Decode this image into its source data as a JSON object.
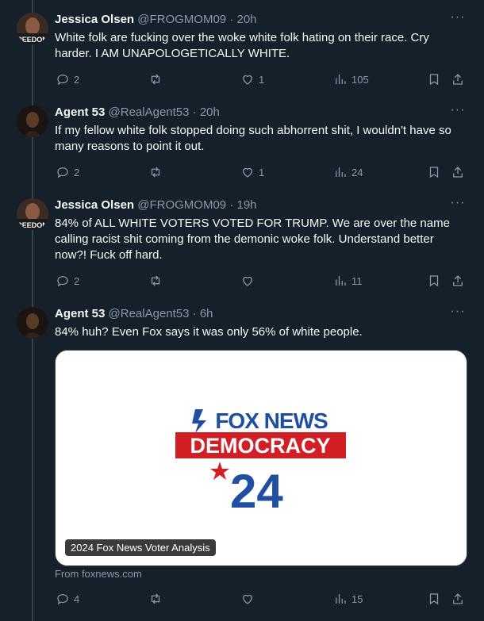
{
  "tweets": [
    {
      "name": "Jessica Olsen",
      "handle": "@FROGMOM09",
      "time": "20h",
      "text": "White folk are fucking over the woke white folk hating on their race. Cry harder. I AM UNAPOLOGETICALLY WHITE.",
      "replies": "2",
      "retweets": "",
      "likes": "1",
      "views": "105",
      "avatar_text": "REEDOM"
    },
    {
      "name": "Agent 53",
      "handle": "@RealAgent53",
      "time": "20h",
      "text": "If my fellow white folk stopped doing such abhorrent shit, I wouldn't have so many reasons to point it out.",
      "replies": "2",
      "retweets": "",
      "likes": "1",
      "views": "24"
    },
    {
      "name": "Jessica Olsen",
      "handle": "@FROGMOM09",
      "time": "19h",
      "text": "84% of ALL WHITE VOTERS VOTED FOR TRUMP. We are over the name calling racist shit coming from the demonic woke folk. Understand better now?! Fuck off hard.",
      "replies": "2",
      "retweets": "",
      "likes": "",
      "views": "11",
      "avatar_text": "REEDOM"
    },
    {
      "name": "Agent 53",
      "handle": "@RealAgent53",
      "time": "6h",
      "text": "84% huh? Even Fox says it was only 56% of white people.",
      "replies": "4",
      "retweets": "",
      "likes": "",
      "views": "15"
    }
  ],
  "card": {
    "logo_fox_news": "FOX NEWS",
    "logo_democracy": "DEMOCRACY",
    "logo_year": "24",
    "label": "2024 Fox News Voter Analysis",
    "source": "From foxnews.com"
  },
  "ui": {
    "dot": "·",
    "more": "···"
  },
  "colors": {
    "background": "#15202b",
    "secondary_text": "#8b98a5",
    "fox_red": "#d21f26",
    "fox_blue": "#1f4ea3"
  }
}
